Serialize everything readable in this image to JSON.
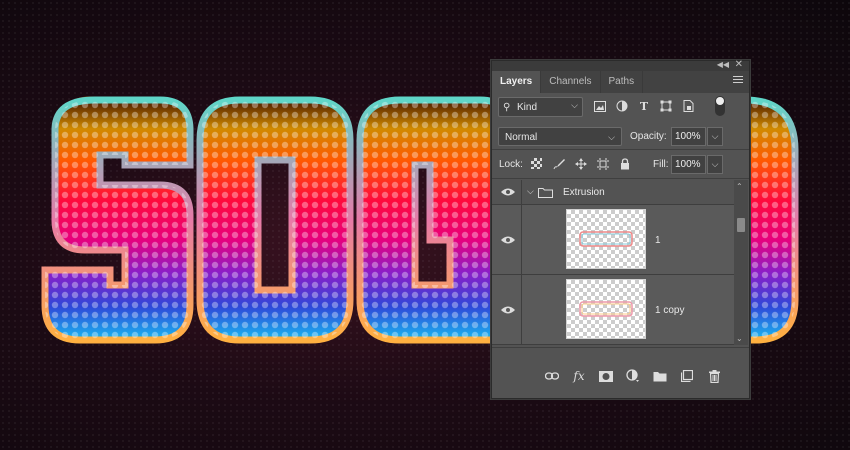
{
  "artwork": {
    "text": "SOGO"
  },
  "layers_panel": {
    "tabs": [
      {
        "label": "Layers",
        "active": true
      },
      {
        "label": "Channels",
        "active": false
      },
      {
        "label": "Paths",
        "active": false
      }
    ],
    "filter": {
      "kind_label": "Kind",
      "icons": [
        "image-filter-icon",
        "adjustment-filter-icon",
        "type-filter-icon",
        "shape-filter-icon",
        "smart-object-filter-icon"
      ]
    },
    "blend_mode": "Normal",
    "opacity_label": "Opacity:",
    "opacity_value": "100%",
    "lock_label": "Lock:",
    "fill_label": "Fill:",
    "fill_value": "100%",
    "layers": [
      {
        "type": "group",
        "name": "Extrusion",
        "visible": true,
        "expanded": true
      },
      {
        "type": "layer",
        "name": "1",
        "visible": true
      },
      {
        "type": "layer",
        "name": "1 copy",
        "visible": true
      },
      {
        "type": "layer",
        "name": "",
        "visible": false
      }
    ],
    "footer_icons": [
      "link-layers-icon",
      "fx-icon",
      "layer-mask-icon",
      "adjustment-layer-icon",
      "new-group-icon",
      "new-layer-icon",
      "delete-layer-icon"
    ],
    "colors": {
      "panel_bg": "#535353",
      "tab_bar_bg": "#424242",
      "field_bg": "#414141"
    }
  }
}
